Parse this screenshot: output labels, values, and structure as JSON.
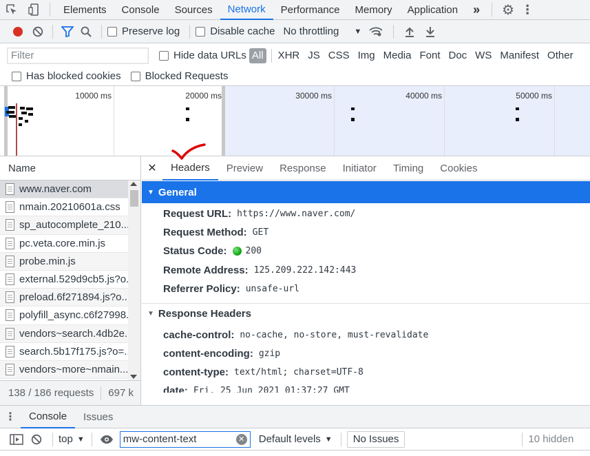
{
  "top_tabs": [
    "Elements",
    "Console",
    "Sources",
    "Network",
    "Performance",
    "Memory",
    "Application"
  ],
  "top_tabs_more": "»",
  "toolbar": {
    "preserve_log": "Preserve log",
    "disable_cache": "Disable cache",
    "throttling": "No throttling"
  },
  "filter": {
    "placeholder": "Filter",
    "hide_data_urls": "Hide data URLs",
    "all": "All",
    "types": [
      "XHR",
      "JS",
      "CSS",
      "Img",
      "Media",
      "Font",
      "Doc",
      "WS",
      "Manifest",
      "Other"
    ],
    "has_blocked_cookies": "Has blocked cookies",
    "blocked_requests": "Blocked Requests"
  },
  "overview": {
    "ticks": [
      "10000 ms",
      "20000 ms",
      "30000 ms",
      "40000 ms",
      "50000 ms"
    ]
  },
  "name_header": "Name",
  "files": [
    "www.naver.com",
    "nmain.20210601a.css",
    "sp_autocomplete_210...",
    "pc.veta.core.min.js",
    "probe.min.js",
    "external.529d9cb5.js?o...",
    "preload.6f271894.js?o...",
    "polyfill_async.c6f27998...",
    "vendors~search.4db2e...",
    "search.5b17f175.js?o=...",
    "vendors~more~nmain..."
  ],
  "status": {
    "requests": "138 / 186 requests",
    "transferred": "697 k"
  },
  "detail_tabs": [
    "Headers",
    "Preview",
    "Response",
    "Initiator",
    "Timing",
    "Cookies"
  ],
  "general": {
    "title": "General",
    "rows": [
      {
        "k": "Request URL:",
        "v": "https://www.naver.com/"
      },
      {
        "k": "Request Method:",
        "v": "GET"
      },
      {
        "k": "Status Code:",
        "v": "200"
      },
      {
        "k": "Remote Address:",
        "v": "125.209.222.142:443"
      },
      {
        "k": "Referrer Policy:",
        "v": "unsafe-url"
      }
    ]
  },
  "response_headers": {
    "title": "Response Headers",
    "rows": [
      {
        "k": "cache-control:",
        "v": "no-cache, no-store, must-revalidate"
      },
      {
        "k": "content-encoding:",
        "v": "gzip"
      },
      {
        "k": "content-type:",
        "v": "text/html; charset=UTF-8"
      },
      {
        "k": "date:",
        "v": "Fri, 25 Jun 2021 01:37:27 GMT"
      }
    ]
  },
  "drawer": {
    "tabs": [
      "Console",
      "Issues"
    ],
    "context": "top",
    "filter_value": "mw-content-text",
    "levels": "Default levels",
    "no_issues": "No Issues",
    "hidden": "10 hidden"
  },
  "colors": {
    "accent": "#1a73e8",
    "record": "#d93025",
    "status_ok": "#0a9e0a",
    "annotation": "#e00000"
  }
}
